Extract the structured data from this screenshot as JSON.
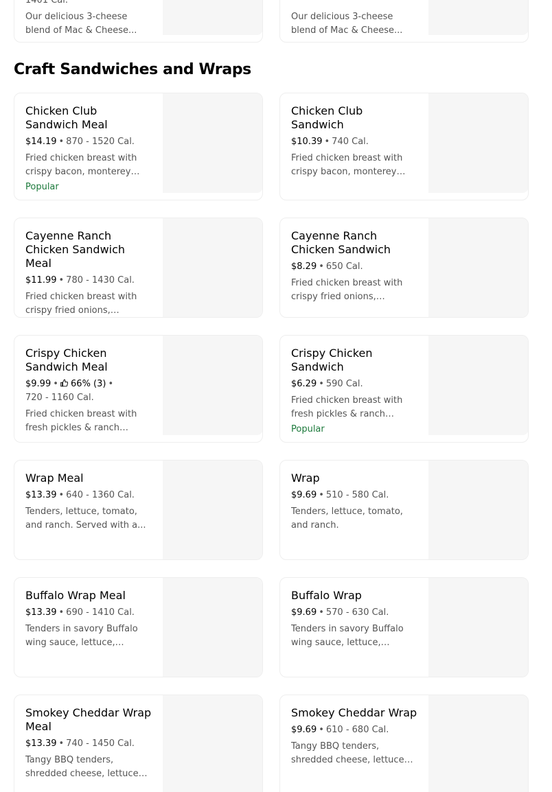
{
  "top_cards": [
    {
      "meta_partial": "1401 Cal.",
      "description": "Our delicious 3-cheese blend of Mac & Cheese..."
    },
    {
      "description": "Our delicious 3-cheese blend of Mac & Cheese..."
    }
  ],
  "section": {
    "title": "Craft Sandwiches and Wraps"
  },
  "items": [
    {
      "name": "Chicken Club Sandwich Meal",
      "price": "$14.19",
      "calories": "870 - 1520 Cal.",
      "description": "Fried chicken breast with crispy bacon, monterey jac...",
      "badge": "Popular"
    },
    {
      "name": "Chicken Club Sandwich",
      "price": "$10.39",
      "calories": "740 Cal.",
      "description": "Fried chicken breast with crispy bacon, monterey jac..."
    },
    {
      "name": "Cayenne Ranch Chicken Sandwich Meal",
      "price": "$11.99",
      "calories": "780 - 1430 Cal.",
      "description": "Fried chicken breast with crispy fried onions, lettuce,..."
    },
    {
      "name": "Cayenne Ranch Chicken Sandwich",
      "price": "$8.29",
      "calories": "650 Cal.",
      "description": "Fried chicken breast with crispy fried onions, lettuce,..."
    },
    {
      "name": "Crispy Chicken Sandwich Meal",
      "price": "$9.99",
      "rating": "66% (3)",
      "calories": "720 - 1160 Cal.",
      "description": "Fried chicken breast with fresh pickles & ranch mayo..."
    },
    {
      "name": "Crispy Chicken Sandwich",
      "price": "$6.29",
      "calories": "590 Cal.",
      "description": "Fried chicken breast with fresh pickles & ranch mayo...",
      "badge": "Popular"
    },
    {
      "name": "Wrap Meal",
      "price": "$13.39",
      "calories": "640 - 1360 Cal.",
      "description": "Tenders, lettuce, tomato, and ranch. Served with a..."
    },
    {
      "name": "Wrap",
      "price": "$9.69",
      "calories": "510 - 580 Cal.",
      "description": "Tenders, lettuce, tomato, and ranch."
    },
    {
      "name": "Buffalo Wrap Meal",
      "price": "$13.39",
      "calories": "690 - 1410 Cal.",
      "description": "Tenders in savory Buffalo wing sauce, lettuce, tomat..."
    },
    {
      "name": "Buffalo Wrap",
      "price": "$9.69",
      "calories": "570 - 630 Cal.",
      "description": "Tenders in savory Buffalo wing sauce, lettuce, tomat..."
    },
    {
      "name": "Smokey Cheddar Wrap Meal",
      "price": "$13.39",
      "calories": "740 - 1450 Cal.",
      "description": "Tangy BBQ tenders, shredded cheese, lettuce &..."
    },
    {
      "name": "Smokey Cheddar Wrap",
      "price": "$9.69",
      "calories": "610 - 680 Cal.",
      "description": "Tangy BBQ tenders, shredded cheese, lettuce &..."
    }
  ],
  "colors": {
    "popular": "#1d7a3c",
    "image_placeholder": "#f6f6f6",
    "border": "#eeeeee",
    "muted_text": "#545454"
  },
  "icons": {
    "rating": "thumbs-up-icon"
  }
}
